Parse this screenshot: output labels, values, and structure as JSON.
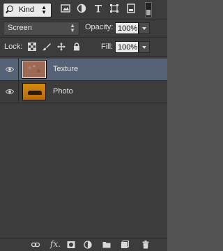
{
  "filter": {
    "kind_label": "Kind"
  },
  "blend": {
    "mode": "Screen",
    "opacity_label": "Opacity:",
    "opacity_value": "100%"
  },
  "lock": {
    "label": "Lock:",
    "fill_label": "Fill:",
    "fill_value": "100%"
  },
  "layers": [
    {
      "name": "Texture",
      "selected": true,
      "visible": true
    },
    {
      "name": "Photo",
      "selected": false,
      "visible": true
    }
  ],
  "icons": {
    "filter": [
      "pixel-layer-filter-icon",
      "adjustment-layer-filter-icon",
      "type-layer-filter-icon",
      "shape-layer-filter-icon",
      "smart-object-filter-icon"
    ],
    "lock": [
      "lock-transparent-pixels-icon",
      "lock-image-pixels-icon",
      "lock-position-icon",
      "lock-all-icon"
    ],
    "bottom": [
      "link-layers-icon",
      "layer-style-icon",
      "layer-mask-icon",
      "adjustment-layer-icon",
      "new-group-icon",
      "new-layer-icon",
      "delete-layer-icon"
    ]
  },
  "bottom": {
    "fx_label": "fx."
  },
  "colors": {
    "panel_bg": "#3c3c3c",
    "selected_row": "#566377"
  }
}
